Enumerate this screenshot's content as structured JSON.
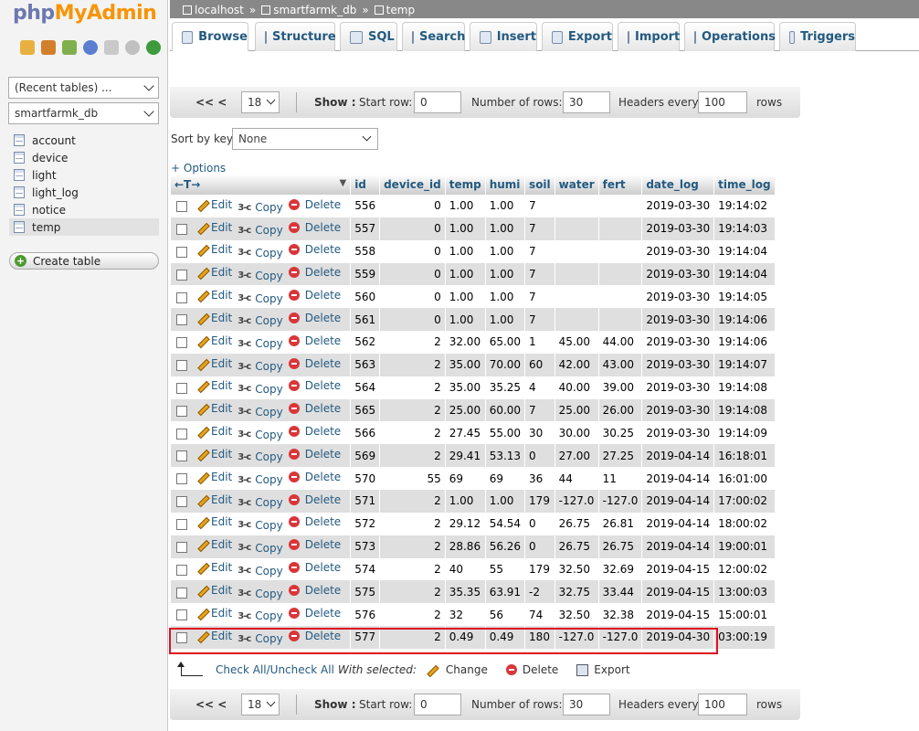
{
  "app": {
    "logo_part1": "php",
    "logo_part2": "MyAdmin"
  },
  "sidebar": {
    "recent": "(Recent tables) ...",
    "database": "smartfarmk_db",
    "tables": [
      {
        "label": "account",
        "active": false
      },
      {
        "label": "device",
        "active": false
      },
      {
        "label": "light",
        "active": false
      },
      {
        "label": "light_log",
        "active": false
      },
      {
        "label": "notice",
        "active": false
      },
      {
        "label": "temp",
        "active": true
      }
    ],
    "create_table": "Create table"
  },
  "breadcrumb": {
    "server": "localhost",
    "database": "smartfarmk_db",
    "table": "temp",
    "sep": "»"
  },
  "tabs": [
    {
      "label": "Browse",
      "icon": "browse-icon",
      "active": true
    },
    {
      "label": "Structure",
      "icon": "structure-icon",
      "active": false
    },
    {
      "label": "SQL",
      "icon": "sql-icon",
      "active": false
    },
    {
      "label": "Search",
      "icon": "search-icon",
      "active": false
    },
    {
      "label": "Insert",
      "icon": "insert-icon",
      "active": false
    },
    {
      "label": "Export",
      "icon": "export-icon",
      "active": false
    },
    {
      "label": "Import",
      "icon": "import-icon",
      "active": false
    },
    {
      "label": "Operations",
      "icon": "wrench-icon",
      "active": false
    },
    {
      "label": "Triggers",
      "icon": "triggers-icon",
      "active": false
    }
  ],
  "nav": {
    "prev": "<<  <",
    "page": "18",
    "show": "Show :",
    "start_row_label": "Start row:",
    "start_row": "0",
    "num_rows_label": "Number of rows:",
    "num_rows": "30",
    "headers_every_label": "Headers every",
    "headers_every": "100",
    "rows": "rows"
  },
  "sort": {
    "label": "Sort by key:",
    "value": "None"
  },
  "options": "+ Options",
  "table": {
    "arrows": "←T→",
    "columns": [
      "id",
      "device_id",
      "temp",
      "humi",
      "soil",
      "water",
      "fert",
      "date_log",
      "time_log"
    ],
    "actions": {
      "edit": "Edit",
      "copy": "Copy",
      "delete": "Delete",
      "copy_icon": "3-c"
    },
    "rows": [
      [
        "556",
        "0",
        "1.00",
        "1.00",
        "7",
        "",
        "",
        "2019-03-30",
        "19:14:02"
      ],
      [
        "557",
        "0",
        "1.00",
        "1.00",
        "7",
        "",
        "",
        "2019-03-30",
        "19:14:03"
      ],
      [
        "558",
        "0",
        "1.00",
        "1.00",
        "7",
        "",
        "",
        "2019-03-30",
        "19:14:04"
      ],
      [
        "559",
        "0",
        "1.00",
        "1.00",
        "7",
        "",
        "",
        "2019-03-30",
        "19:14:04"
      ],
      [
        "560",
        "0",
        "1.00",
        "1.00",
        "7",
        "",
        "",
        "2019-03-30",
        "19:14:05"
      ],
      [
        "561",
        "0",
        "1.00",
        "1.00",
        "7",
        "",
        "",
        "2019-03-30",
        "19:14:06"
      ],
      [
        "562",
        "2",
        "32.00",
        "65.00",
        "1",
        "45.00",
        "44.00",
        "2019-03-30",
        "19:14:06"
      ],
      [
        "563",
        "2",
        "35.00",
        "70.00",
        "60",
        "42.00",
        "43.00",
        "2019-03-30",
        "19:14:07"
      ],
      [
        "564",
        "2",
        "35.00",
        "35.25",
        "4",
        "40.00",
        "39.00",
        "2019-03-30",
        "19:14:08"
      ],
      [
        "565",
        "2",
        "25.00",
        "60.00",
        "7",
        "25.00",
        "26.00",
        "2019-03-30",
        "19:14:08"
      ],
      [
        "566",
        "2",
        "27.45",
        "55.00",
        "30",
        "30.00",
        "30.25",
        "2019-03-30",
        "19:14:09"
      ],
      [
        "569",
        "2",
        "29.41",
        "53.13",
        "0",
        "27.00",
        "27.25",
        "2019-04-14",
        "16:18:01"
      ],
      [
        "570",
        "55",
        "69",
        "69",
        "36",
        "44",
        "11",
        "2019-04-14",
        "16:01:00"
      ],
      [
        "571",
        "2",
        "1.00",
        "1.00",
        "179",
        "-127.0",
        "-127.0",
        "2019-04-14",
        "17:00:02"
      ],
      [
        "572",
        "2",
        "29.12",
        "54.54",
        "0",
        "26.75",
        "26.81",
        "2019-04-14",
        "18:00:02"
      ],
      [
        "573",
        "2",
        "28.86",
        "56.26",
        "0",
        "26.75",
        "26.75",
        "2019-04-14",
        "19:00:01"
      ],
      [
        "574",
        "2",
        "40",
        "55",
        "179",
        "32.50",
        "32.69",
        "2019-04-15",
        "12:00:02"
      ],
      [
        "575",
        "2",
        "35.35",
        "63.91",
        "-2",
        "32.75",
        "33.44",
        "2019-04-15",
        "13:00:03"
      ],
      [
        "576",
        "2",
        "32",
        "56",
        "74",
        "32.50",
        "32.38",
        "2019-04-15",
        "15:00:01"
      ],
      [
        "577",
        "2",
        "0.49",
        "0.49",
        "180",
        "-127.0",
        "-127.0",
        "2019-04-30",
        "03:00:19"
      ]
    ]
  },
  "footer": {
    "check_all": "Check All",
    "slash": " / ",
    "uncheck_all": "Uncheck All",
    "with_selected": "With selected:",
    "change": "Change",
    "delete": "Delete",
    "export": "Export"
  }
}
